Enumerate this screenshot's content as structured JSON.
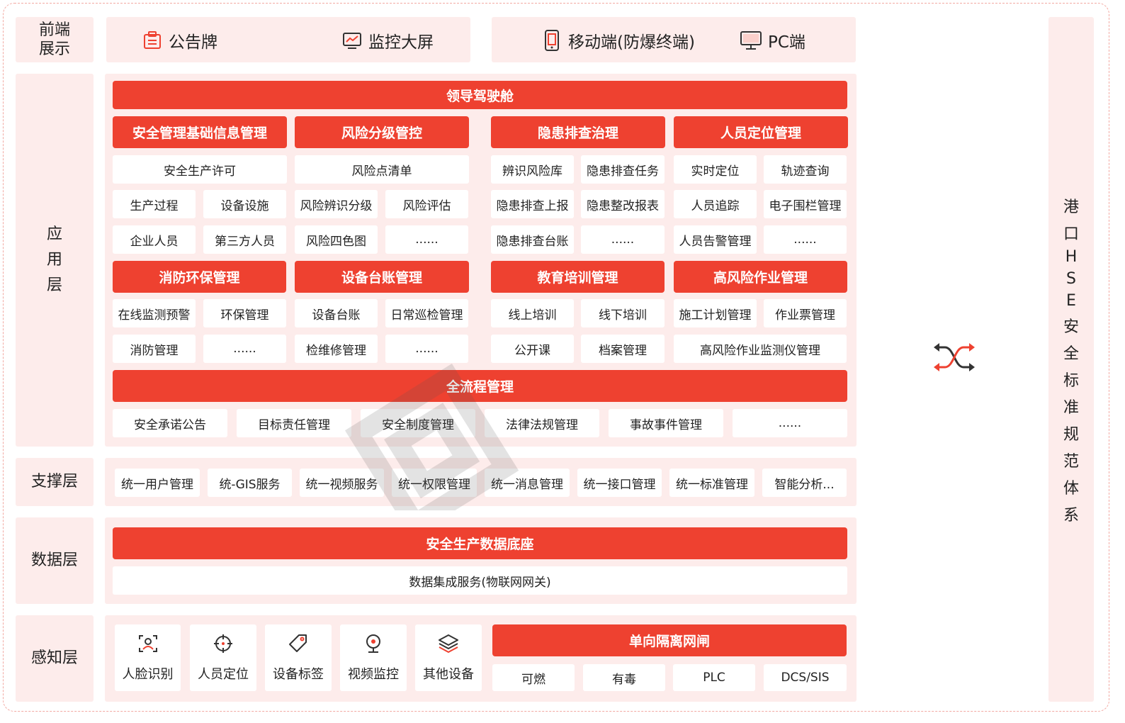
{
  "colors": {
    "accent": "#ee4130",
    "panel": "#fdeceb",
    "border": "#f2a9a2"
  },
  "layers": {
    "front": [
      "前端",
      "展示"
    ],
    "app": [
      "应",
      "用",
      "层"
    ],
    "support": "支撑层",
    "data": "数据层",
    "sense": "感知层"
  },
  "front": {
    "items": [
      {
        "label": "公告牌",
        "icon": "clipboard-icon"
      },
      {
        "label": "监控大屏",
        "icon": "monitor-chart-icon"
      },
      {
        "label": "移动端(防爆终端)",
        "icon": "mobile-icon"
      },
      {
        "label": "PC端",
        "icon": "pc-icon"
      }
    ]
  },
  "app": {
    "cockpit": "领导驾驶舱",
    "groups": {
      "g1": "安全管理基础信息管理",
      "g2": "风险分级管控",
      "g3": "隐患排查治理",
      "g4": "人员定位管理",
      "g5": "消防环保管理",
      "g6": "设备台账管理",
      "g7": "教育培训管理",
      "g8": "高风险作业管理"
    },
    "cells": {
      "c1": "安全生产许可",
      "c2": "风险点清单",
      "c3": "辨识风险库",
      "c4": "隐患排查任务",
      "c5": "实时定位",
      "c6": "轨迹查询",
      "c7": "生产过程",
      "c8": "设备设施",
      "c9": "风险辨识分级",
      "c10": "风险评估",
      "c11": "隐患排查上报",
      "c12": "隐患整改报表",
      "c13": "人员追踪",
      "c14": "电子围栏管理",
      "c15": "企业人员",
      "c16": "第三方人员",
      "c17": "风险四色图",
      "c18": "......",
      "c19": "隐患排查台账",
      "c20": "......",
      "c21": "人员告警管理",
      "c22": "......",
      "c23": "在线监测预警",
      "c24": "环保管理",
      "c25": "设备台账",
      "c26": "日常巡检管理",
      "c27": "线上培训",
      "c28": "线下培训",
      "c29": "施工计划管理",
      "c30": "作业票管理",
      "c31": "消防管理",
      "c32": "......",
      "c33": "检维修管理",
      "c34": "......",
      "c35": "公开课",
      "c36": "档案管理",
      "c37": "高风险作业监测仪管理"
    },
    "process": "全流程管理",
    "process_items": [
      "安全承诺公告",
      "目标责任管理",
      "安全制度管理",
      "法律法规管理",
      "事故事件管理",
      "......"
    ]
  },
  "support": {
    "items": [
      "统一用户管理",
      "统-GIS服务",
      "统一视频服务",
      "统一权限管理",
      "统一消息管理",
      "统一接口管理",
      "统一标准管理",
      "智能分析..."
    ]
  },
  "data": {
    "base": "安全生产数据底座",
    "service": "数据集成服务(物联网网关)"
  },
  "sense": {
    "devices": [
      {
        "label": "人脸识别",
        "icon": "face-scan-icon"
      },
      {
        "label": "人员定位",
        "icon": "crosshair-icon"
      },
      {
        "label": "设备标签",
        "icon": "tag-icon"
      },
      {
        "label": "视频监控",
        "icon": "camera-icon"
      },
      {
        "label": "其他设备",
        "icon": "layers-icon"
      }
    ],
    "gateway": "单向隔离网闸",
    "gateway_items": [
      "可燃",
      "有毒",
      "PLC",
      "DCS/SIS"
    ]
  },
  "right": {
    "chars": [
      "港",
      "口",
      "H",
      "S",
      "E",
      "安",
      "全",
      "标",
      "准",
      "规",
      "范",
      "体",
      "系"
    ]
  }
}
